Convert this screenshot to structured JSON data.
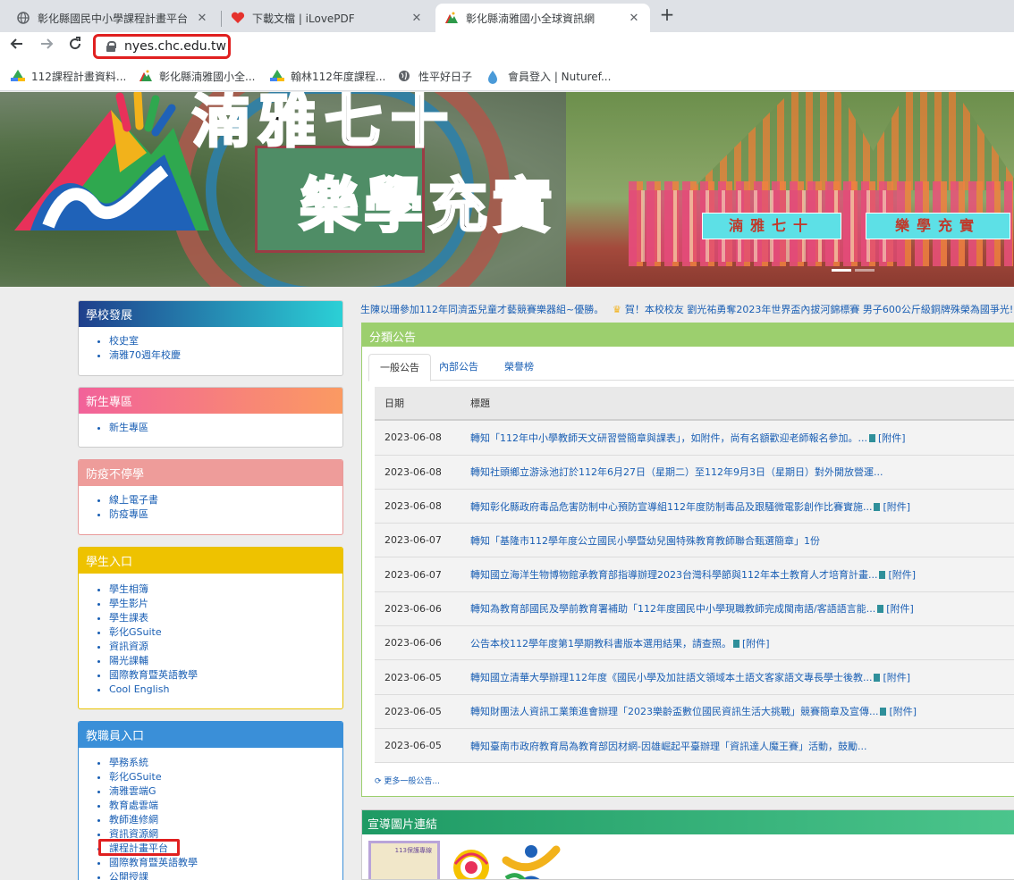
{
  "browser": {
    "tabs": [
      {
        "title": "彰化縣國民中小學課程計畫平台",
        "icon": "globe-icon"
      },
      {
        "title": "下載文檔 | iLovePDF",
        "icon": "heart-icon"
      },
      {
        "title": "彰化縣湳雅國小全球資訊網",
        "icon": "school-logo-icon"
      }
    ],
    "new_tab_glyph": "+",
    "close_glyph": "✕",
    "url": "nyes.chc.edu.tw",
    "bookmarks": [
      {
        "label": "112課程計畫資料...",
        "icon": "drive-icon"
      },
      {
        "label": "彰化縣湳雅國小全...",
        "icon": "school-logo-icon"
      },
      {
        "label": "翰林112年度課程...",
        "icon": "drive-icon"
      },
      {
        "label": "性平好日子",
        "icon": "globe-icon"
      },
      {
        "label": "會員登入 | Nuturef...",
        "icon": "flame-icon"
      }
    ]
  },
  "banner": {
    "title_line1": "湳雅七十",
    "title_line2": "樂學充實",
    "sign_left": "湳雅七十",
    "sign_right": "樂學充實"
  },
  "sidebar": {
    "school_dev": {
      "title": "學校發展",
      "items": [
        "校史室",
        "湳雅70週年校慶"
      ],
      "color": "#2b4c9b"
    },
    "new_students": {
      "title": "新生專區",
      "items": [
        "新生專區"
      ],
      "color": "#e85a8a"
    },
    "epidemic": {
      "title": "防疫不停學",
      "items": [
        "線上電子書",
        "防疫專區"
      ],
      "color": "#e07a7a"
    },
    "student_portal": {
      "title": "學生入口",
      "items": [
        "學生相簿",
        "學生影片",
        "學生課表",
        "彰化GSuite",
        "資訊資源",
        "陽光課輔",
        "國際教育暨英語教學",
        "Cool English"
      ],
      "color": "#e8c200"
    },
    "staff_portal": {
      "title": "教職員入口",
      "items": [
        "學務系統",
        "彰化GSuite",
        "湳雅雲端G",
        "教育處雲端",
        "教師進修網",
        "資訊資源網",
        "課程計畫平台",
        "國際教育暨英語教學",
        "公開授課"
      ],
      "color": "#3a8fd8"
    }
  },
  "marquee": {
    "msg1": "生陳以珊參加112年同濟盃兒童才藝競賽樂器組~優勝。",
    "msg2": "賀！本校校友 劉光祐勇奪2023年世界盃內拔河錦標賽 男子600公斤級銅牌殊榮為國爭光!"
  },
  "announcements": {
    "title": "分類公告",
    "tabs": [
      "一般公告",
      "內部公告",
      "榮譽榜"
    ],
    "col_date": "日期",
    "col_title": "標題",
    "attach_label": "[附件]",
    "rows": [
      {
        "date": "2023-06-08",
        "title": "轉知「112年中小學教師天文研習營簡章與課表」，如附件，尚有名額歡迎老師報名參加。...",
        "attach": "[附件]"
      },
      {
        "date": "2023-06-08",
        "title": "轉知社頭鄉立游泳池訂於112年6月27日（星期二）至112年9月3日（星期日）對外開放營運...",
        "attach": ""
      },
      {
        "date": "2023-06-08",
        "title": "轉知彰化縣政府毒品危害防制中心預防宣導組112年度防制毒品及跟騷微電影創作比賽實施...",
        "attach": "[附件]"
      },
      {
        "date": "2023-06-07",
        "title": "轉知「基隆市112學年度公立國民小學暨幼兒園特殊教育教師聯合甄選簡章」1份",
        "attach": ""
      },
      {
        "date": "2023-06-07",
        "title": "轉知國立海洋生物博物館承教育部指導辦理2023台灣科學節與112年本土教育人才培育計畫...",
        "attach": "[附件]"
      },
      {
        "date": "2023-06-06",
        "title": "轉知為教育部國民及學前教育署補助「112年度國民中小學現職教師完成閩南語/客語語言能...",
        "attach": "[附件]"
      },
      {
        "date": "2023-06-06",
        "title": "公告本校112學年度第1學期教科書版本選用結果，請查照。",
        "attach": "[附件]"
      },
      {
        "date": "2023-06-05",
        "title": "轉知國立清華大學辦理112年度《國民小學及加註語文領域本土語文客家語文專長學士後教...",
        "attach": "[附件]"
      },
      {
        "date": "2023-06-05",
        "title": "轉知財團法人資訊工業策進會辦理「2023樂齡盃數位國民資訊生活大挑戰」競賽簡章及宣傳...",
        "attach": "[附件]"
      },
      {
        "date": "2023-06-05",
        "title": "轉知臺南市政府教育局為教育部因材網-因雄崛起平臺辦理「資訊達人魔王賽」活動，鼓勵...",
        "attach": ""
      }
    ],
    "more": "更多一般公告..."
  },
  "promo": {
    "title": "宣導圖片連結",
    "img1_text": "113保護專線"
  }
}
